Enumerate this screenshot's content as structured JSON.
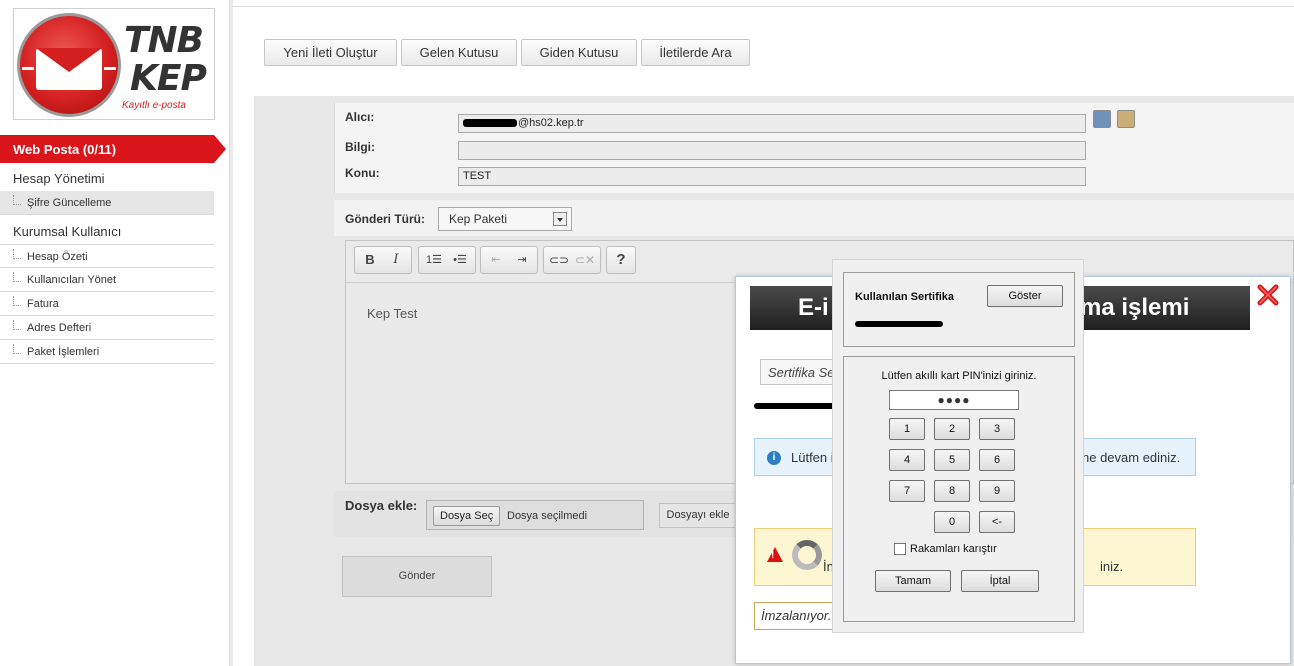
{
  "brand": {
    "logo_top": "TNB",
    "logo_bottom": "KEP",
    "tagline": "Kayıtlı e-posta",
    "brand_red": "#d9141b"
  },
  "sidebar": {
    "active_item": "Web Posta (0/11)",
    "sections": [
      {
        "heading": "Hesap Yönetimi",
        "items": [
          "Şifre Güncelleme"
        ]
      },
      {
        "heading": "Kurumsal Kullanıcı",
        "items": [
          "Hesap Özeti",
          "Kullanıcıları Yönet",
          "Fatura",
          "Adres Defteri",
          "Paket İşlemleri"
        ]
      }
    ]
  },
  "toolbar": {
    "buttons": [
      "Yeni İleti Oluştur",
      "Gelen Kutusu",
      "Giden Kutusu",
      "İletilerde Ara"
    ]
  },
  "compose": {
    "to_label": "Alıcı:",
    "to_value_visible": "@hs02.kep.tr",
    "cc_label": "Bilgi:",
    "cc_value": "",
    "subject_label": "Konu:",
    "subject_value": "TEST",
    "type_label": "Gönderi Türü:",
    "type_value": "Kep Paketi",
    "body_text": "Kep Test",
    "attach_label": "Dosya ekle:",
    "choose_file_button": "Dosya Seç",
    "no_file_text": "Dosya seçilmedi",
    "add_file_button": "Dosyayı ekle",
    "send_button": "Gönder"
  },
  "editor_tools": [
    "bold",
    "italic",
    "ordered-list",
    "unordered-list",
    "outdent",
    "indent",
    "link",
    "unlink",
    "help"
  ],
  "sign_dialog": {
    "title_left": "E-i",
    "title_right": "ma işlemi",
    "certificate_select": "Sertifika Se",
    "info_left": "Lütfen i",
    "info_right": "ne devam ediniz.",
    "warning_left": "İn",
    "warning_right": "iniz.",
    "status_text": "İmzalanıyor..."
  },
  "pin_dialog": {
    "cert_label": "Kullanılan Sertifika",
    "show_button": "Göster",
    "prompt": "Lütfen akıllı kart PIN'inizi giriniz.",
    "pin_value": "●●●●",
    "keys": [
      "1",
      "2",
      "3",
      "4",
      "5",
      "6",
      "7",
      "8",
      "9",
      "0",
      "<-"
    ],
    "shuffle_label": "Rakamları karıştır",
    "ok_button": "Tamam",
    "cancel_button": "İptal"
  }
}
